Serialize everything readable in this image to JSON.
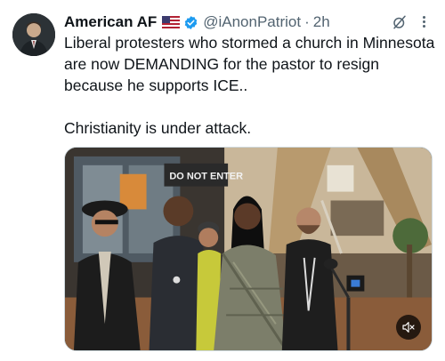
{
  "author": {
    "display_name": "American AF",
    "handle": "@iAnonPatriot",
    "separator": "·",
    "time": "2h"
  },
  "icons": {
    "flag": "us-flag-icon",
    "verified": "verified-badge-icon",
    "grok": "grok-icon",
    "more": "more-options-icon",
    "mute": "muted-volume-icon"
  },
  "colors": {
    "verified": "#1d9bf0",
    "secondary_text": "#536471",
    "primary_text": "#0f1419"
  },
  "tweet": {
    "paragraph_1": "Liberal protesters who stormed a church in Minnesota are now DEMANDING for the pastor to resign because he supports ICE..",
    "paragraph_2": "Christianity is under attack."
  },
  "media": {
    "sign_text": "DO NOT ENTER"
  }
}
